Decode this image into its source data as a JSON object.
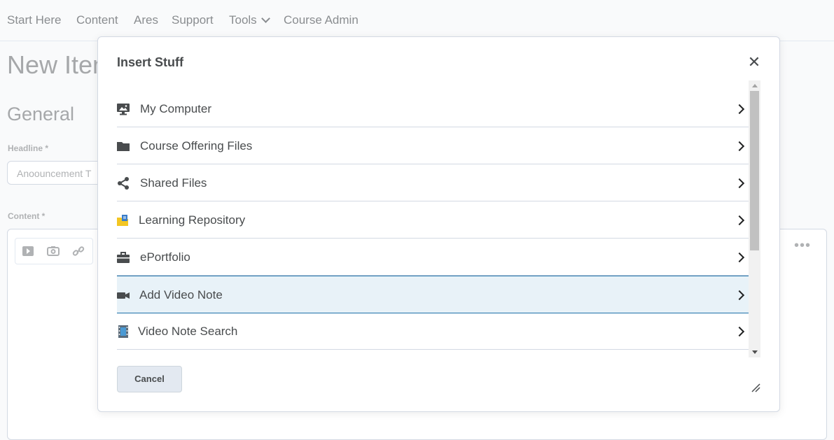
{
  "nav": {
    "items": [
      "Start Here",
      "Content",
      "Ares",
      "Support",
      "Tools",
      "Course Admin"
    ]
  },
  "page": {
    "title": "New Item",
    "section": "General",
    "headline_label": "Headline *",
    "headline_placeholder": "Anoouncement T",
    "content_label": "Content *"
  },
  "dialog": {
    "title": "Insert Stuff",
    "close_icon": "close-icon",
    "items": [
      {
        "label": "My Computer",
        "icon": "computer-icon"
      },
      {
        "label": "Course Offering Files",
        "icon": "folder-icon"
      },
      {
        "label": "Shared Files",
        "icon": "share-icon"
      },
      {
        "label": "Learning Repository",
        "icon": "repository-icon"
      },
      {
        "label": "ePortfolio",
        "icon": "briefcase-icon"
      },
      {
        "label": "Add Video Note",
        "icon": "video-camera-icon",
        "selected": true
      },
      {
        "label": "Video Note Search",
        "icon": "film-icon"
      }
    ],
    "cancel_label": "Cancel"
  },
  "colors": {
    "selected_row_bg": "#e8f2f8",
    "selected_row_border": "#1b6fa8",
    "button_bg": "#e3e9f1"
  }
}
